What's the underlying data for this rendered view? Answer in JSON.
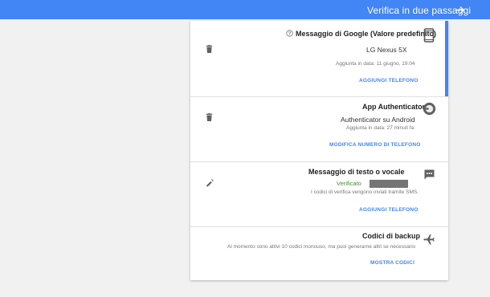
{
  "header": {
    "title": "Verifica in due passaggi",
    "back_icon": "arrow-icon"
  },
  "sections": {
    "google_prompt": {
      "title": "Messaggio di Google (Valore predefinito)",
      "device": "LG Nexus 5X",
      "added": "Aggiunta in data: 11 giugno, 19:04",
      "action": "AGGIUNGI TELEFONO",
      "icon": "phone-icon"
    },
    "authenticator": {
      "title": "App Authenticator",
      "device": "Authenticator su Android",
      "added": "Aggiunta in data: 27 minuti fa",
      "action": "MODIFICA NUMERO DI TELEFONO",
      "icon": "authenticator-icon"
    },
    "sms_voice": {
      "title": "Messaggio di testo o vocale",
      "status": "Verificato",
      "description": "I codici di verifica vengono inviati tramite SMS.",
      "action": "AGGIUNGI TELEFONO",
      "icon": "message-icon"
    },
    "backup": {
      "title": "Codici di backup",
      "description": "Al momento sono attivi 10 codici monouso, ma puoi generarne altri se necessario",
      "action": "MOSTRA CODICI",
      "icon": "airplane-icon"
    }
  },
  "colors": {
    "accent": "#4285f4",
    "verified": "#4a8c3b"
  }
}
